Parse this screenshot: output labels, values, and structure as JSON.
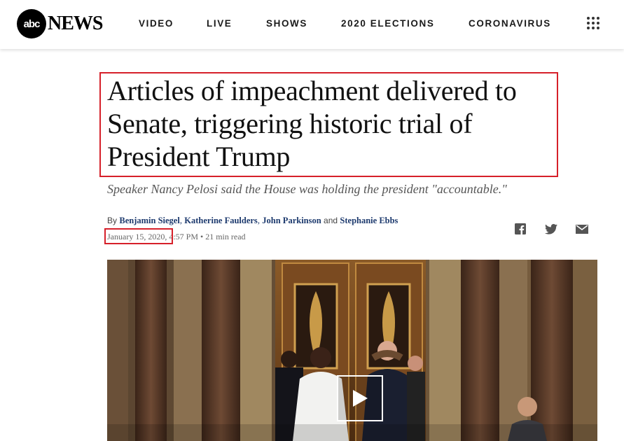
{
  "header": {
    "logo": {
      "abc": "abc",
      "news": "NEWS"
    },
    "nav": [
      {
        "label": "VIDEO"
      },
      {
        "label": "LIVE"
      },
      {
        "label": "SHOWS"
      },
      {
        "label": "2020 ELECTIONS"
      },
      {
        "label": "CORONAVIRUS"
      }
    ],
    "menu_icon": "grid-menu-icon"
  },
  "article": {
    "headline": "Articles of impeachment delivered to Senate, triggering historic trial of President Trump",
    "subhead": "Speaker Nancy Pelosi said the House was holding the president \"accountable.\"",
    "byline": {
      "prefix": "By",
      "authors": [
        "Benjamin Siegel",
        "Katherine Faulders",
        "John Parkinson",
        "Stephanie Ebbs"
      ],
      "sep1": ",",
      "sep2": ",",
      "and": "and"
    },
    "date": "January 15, 2020",
    "time": ", 4:57 PM",
    "read_time": "• 21 min read",
    "share_icons": [
      "facebook-icon",
      "twitter-icon",
      "email-icon"
    ]
  },
  "colors": {
    "highlight": "#d6202a",
    "author_link": "#1d3a6e"
  }
}
